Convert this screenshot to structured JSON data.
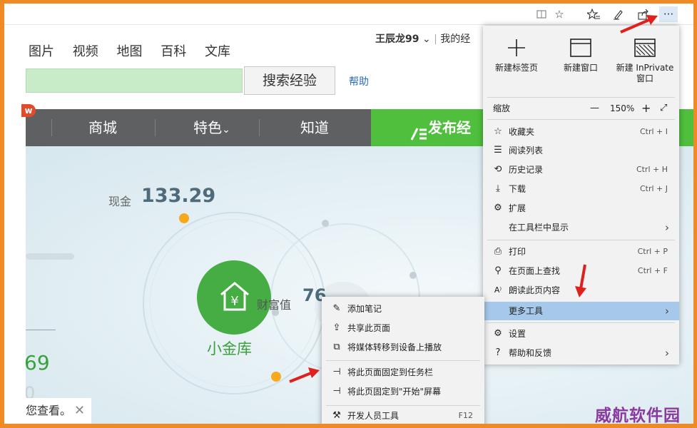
{
  "toolbar": {
    "icons": [
      "reading-view-icon",
      "favorite-star-icon",
      "favorites-hub-icon",
      "notes-pen-icon",
      "share-icon",
      "more-icon"
    ],
    "more_label": "···"
  },
  "page": {
    "nav_links": [
      "图片",
      "视频",
      "地图",
      "百科",
      "文库"
    ],
    "user_name": "王辰龙99",
    "user_caret": "⌄",
    "user_sep": "|",
    "user_link": "我的经",
    "search_button": "搜索经验",
    "help_link": "帮助",
    "new_badge": "w",
    "menubar": {
      "items": [
        "商城",
        "特色",
        "知道"
      ],
      "feature_caret": "⌄",
      "publish": "发布经"
    },
    "finance": {
      "cash_label": "现金",
      "cash_value": "133.29",
      "center_label": "小金库",
      "wealth_label": "财富值",
      "wealth_value": "76",
      "left_number": "69",
      "left_number2": "0"
    },
    "toast": {
      "text": "您查看。",
      "close": "✕"
    }
  },
  "edge_menu": {
    "top_buttons": [
      {
        "label": "新建标签页",
        "icon": "plus-icon"
      },
      {
        "label": "新建窗口",
        "icon": "window-icon"
      },
      {
        "label": "新建 InPrivate 窗口",
        "icon": "inprivate-window-icon"
      }
    ],
    "zoom": {
      "label": "缩放",
      "minus": "—",
      "value": "150%",
      "plus": "+",
      "fullscreen": "⤢"
    },
    "group1": [
      {
        "label": "收藏夹",
        "shortcut": "Ctrl + I",
        "icon": "favorites-icon"
      },
      {
        "label": "阅读列表",
        "shortcut": "",
        "icon": "reading-list-icon"
      },
      {
        "label": "历史记录",
        "shortcut": "Ctrl + H",
        "icon": "history-icon"
      },
      {
        "label": "下载",
        "shortcut": "Ctrl + J",
        "icon": "download-icon"
      },
      {
        "label": "扩展",
        "shortcut": "",
        "icon": "extensions-icon"
      },
      {
        "label": "在工具栏中显示",
        "shortcut": "",
        "icon": ""
      }
    ],
    "group2": [
      {
        "label": "打印",
        "shortcut": "Ctrl + P",
        "icon": "print-icon"
      },
      {
        "label": "在页面上查找",
        "shortcut": "Ctrl + F",
        "icon": "find-icon"
      },
      {
        "label": "朗读此页内容",
        "shortcut": "",
        "icon": "read-aloud-icon"
      },
      {
        "label": "更多工具",
        "shortcut": "",
        "icon": ""
      }
    ],
    "group3": [
      {
        "label": "设置",
        "shortcut": "",
        "icon": "settings-icon"
      },
      {
        "label": "帮助和反馈",
        "shortcut": "",
        "icon": "help-icon"
      }
    ],
    "arrow": "›"
  },
  "sub_menu": {
    "items": [
      {
        "label": "添加笔记",
        "shortcut": "",
        "icon": "note-pen-icon"
      },
      {
        "label": "共享此页面",
        "shortcut": "",
        "icon": "share-icon"
      },
      {
        "label": "将媒体转移到设备上播放",
        "shortcut": "",
        "icon": "cast-icon"
      },
      {
        "label": "将此页面固定到任务栏",
        "shortcut": "",
        "icon": "pin-icon"
      },
      {
        "label": "将此页固定到\"开始\"屏幕",
        "shortcut": "",
        "icon": "pin-icon"
      },
      {
        "label": "开发人员工具",
        "shortcut": "F12",
        "icon": "devtools-icon"
      }
    ]
  },
  "watermark": "威航软件园",
  "colors": {
    "frame_border": "#f08a24",
    "menubar": "#5f6061",
    "publish_green": "#4fbf3d",
    "highlight": "#a6c8ea",
    "arrow_red": "#e0201c",
    "watermark": "#8a3aa0"
  }
}
